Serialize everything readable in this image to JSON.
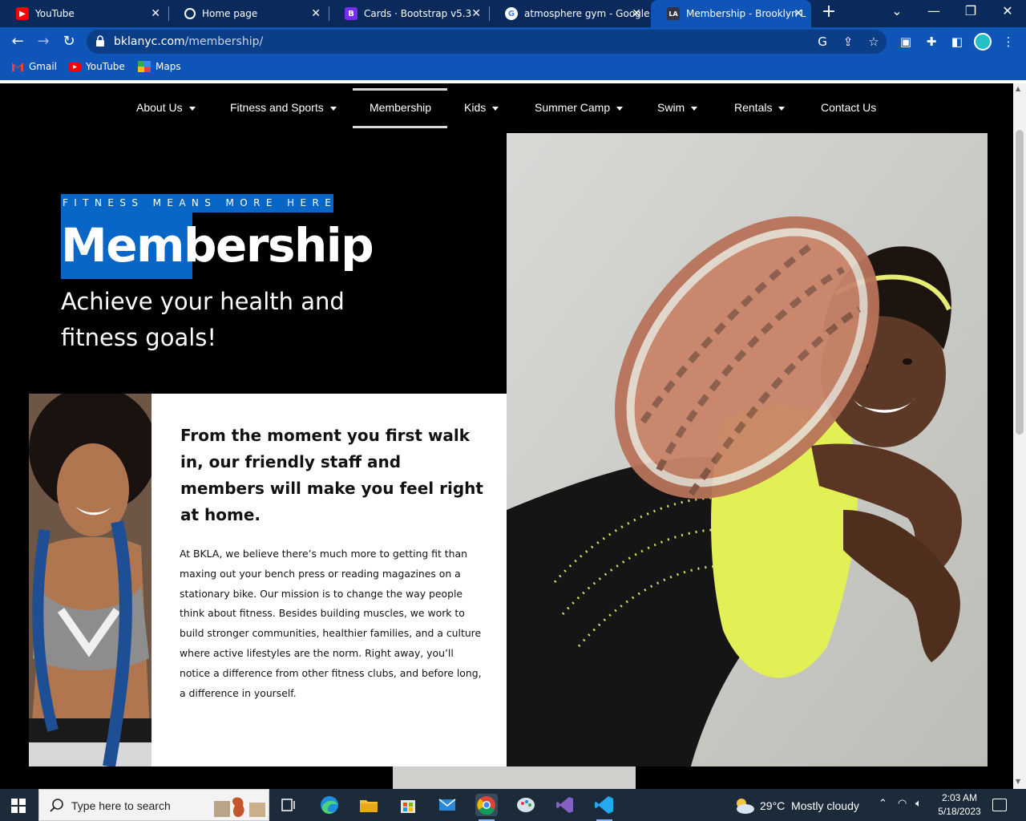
{
  "browser": {
    "tabs": [
      {
        "title": "YouTube",
        "icon": "youtube-icon"
      },
      {
        "title": "Home page",
        "icon": "globe-icon"
      },
      {
        "title": "Cards · Bootstrap v5.3",
        "icon": "bootstrap-icon"
      },
      {
        "title": "atmosphere gym - Google",
        "icon": "google-icon"
      },
      {
        "title": "Membership - Brooklyn L",
        "icon": "bkla-icon",
        "active": true
      }
    ],
    "url_host": "bklanyc.com",
    "url_path": "/membership/",
    "bookmarks": [
      {
        "label": "Gmail",
        "icon": "gmail-icon"
      },
      {
        "label": "YouTube",
        "icon": "youtube-icon"
      },
      {
        "label": "Maps",
        "icon": "maps-icon"
      }
    ]
  },
  "nav": {
    "items": [
      {
        "label": "About Us",
        "dropdown": true
      },
      {
        "label": "Fitness and Sports",
        "dropdown": true
      },
      {
        "label": "Membership",
        "dropdown": false,
        "active": true
      },
      {
        "label": "Kids",
        "dropdown": true
      },
      {
        "label": "Summer Camp",
        "dropdown": true
      },
      {
        "label": "Swim",
        "dropdown": true
      },
      {
        "label": "Rentals",
        "dropdown": true
      },
      {
        "label": "Contact Us",
        "dropdown": false
      }
    ]
  },
  "hero": {
    "eyebrow": "FITNESS MEANS MORE HERE",
    "title": "Membership",
    "subtitle": "Achieve your health and fitness goals!"
  },
  "card": {
    "heading": "From the moment you first walk in, our friendly staff and members will make you feel right at home.",
    "body": "At BKLA, we believe there’s much more to getting fit than maxing out your bench press or reading magazines on a stationary bike. Our mission is to change the way people think about fitness. Besides building muscles, we work to build stronger communities, healthier families, and a culture where active lifestyles are the norm. Right away, you’ll notice a difference from other fitness clubs, and before long, a difference in yourself."
  },
  "taskbar": {
    "search_placeholder": "Type here to search",
    "weather": "29°C  Mostly cloudy",
    "time": "2:03 AM",
    "date": "5/18/2023"
  },
  "colors": {
    "accent": "#0866c6",
    "chrome": "#0f55b8",
    "chrome_dark": "#0a2a5c"
  }
}
